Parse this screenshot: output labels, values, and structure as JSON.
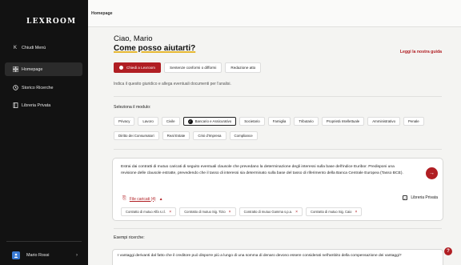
{
  "app": {
    "logo": "LEXROOM",
    "breadcrumb": "Homepage"
  },
  "sidebar": {
    "collapse_label": "Chiudi Menù",
    "items": [
      {
        "label": "Homepage",
        "icon": "grid-icon",
        "active": true
      },
      {
        "label": "Storico Ricerche",
        "icon": "history-icon",
        "active": false
      },
      {
        "label": "Libreria Privata",
        "icon": "book-icon",
        "active": false
      }
    ],
    "user_name": "Mario Rossi"
  },
  "main": {
    "greeting": "Ciao, Mario",
    "help": "Come posso aiutarti?",
    "guide_link": "Leggi la nostra guida",
    "tabs": [
      "Chiedi a Lexroom",
      "Sentenze conformi o difformi",
      "Redazione atto"
    ],
    "intro": "Indica il quesito giuridico e allega eventuali documenti per l'analisi.",
    "module_title": "Seleziona il modulo:",
    "modules_row1": [
      "Privacy",
      "Lavoro",
      "Civile",
      "Bancario e Assicurativo",
      "Societario",
      "Famiglia",
      "Tributario",
      "Proprietà Intellettuale",
      "Amministrativo",
      "Penale"
    ],
    "modules_row2": [
      "Diritto dei Consumatori",
      "Real Estate",
      "Crisi d'Impresa",
      "Compliance"
    ],
    "selected_module": "Bancario e Assicurativo"
  },
  "query": {
    "text": "Estrai dai contratti di mutuo caricati di seguito eventuali clausole che prevedano la determinazione degli interessi sulla base dell'indice Euribor. Predisponi una revisione delle clausole estratte, prevedendo che il tasso di interessi sia determinato sulla base del tasso di riferimento della Banca Centrale Europea (Tasso BCE).",
    "files_label": "File caricati (4)",
    "private_label": "Libreria Privata",
    "files": [
      "Contratto di mutuo Alfa s.r.l.",
      "Contratto di mutuo Sig. Tizio",
      "Contratto di mutuo Gamma s.p.a.",
      "Contratto di mutuo Sig. Caio"
    ]
  },
  "examples": {
    "title": "Esempi ricerche:",
    "items": [
      "I vantaggi derivanti dal fatto che il creditore può disporre più a lungo di una somma di denaro devono essere considerati nell'ambito della compensazione dei vantaggi?"
    ]
  },
  "help_bubble": "?",
  "colors": {
    "accent": "#b01e23",
    "sidebar": "#121212",
    "highlight": "#e6b833"
  }
}
